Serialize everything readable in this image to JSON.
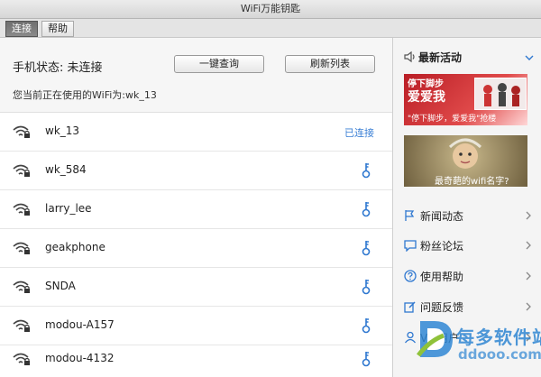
{
  "window": {
    "title": "WiFi万能钥匙"
  },
  "tabs": [
    {
      "label": "连接"
    },
    {
      "label": "帮助"
    }
  ],
  "status": {
    "phone_status": "手机状态: 未连接",
    "query_button": "一键查询",
    "refresh_button": "刷新列表",
    "current_wifi": "您当前正在使用的WiFi为:wk_13"
  },
  "networks": [
    {
      "name": "wk_13",
      "status": "已连接"
    },
    {
      "name": "wk_584"
    },
    {
      "name": "larry_lee"
    },
    {
      "name": "geakphone"
    },
    {
      "name": "SNDA"
    },
    {
      "name": "modou-A157"
    },
    {
      "name": "modou-4132"
    }
  ],
  "sidebar": {
    "activity_title": "最新活动",
    "banner1": {
      "line1": "停下脚步",
      "line2": "爱爱我",
      "caption": "\"停下脚步，爱爱我\"抢楼"
    },
    "banner2": {
      "caption": "最奇葩的wifi名字?"
    },
    "items": [
      {
        "label": "新闻动态"
      },
      {
        "label": "粉丝论坛"
      },
      {
        "label": "使用帮助"
      },
      {
        "label": "问题反馈"
      },
      {
        "label": "VIP用户"
      }
    ]
  },
  "watermark": {
    "text": "每多软件站",
    "url": "ddooo.com"
  },
  "colors": {
    "accent": "#3a7fd5",
    "banner1_bg": "#c9242b",
    "banner2_bg": "#8a7a5a"
  },
  "icons": {
    "wifi": "wifi-lock-icon",
    "key": "key-icon",
    "speaker": "speaker-icon",
    "chevron": "chevron-right-icon"
  }
}
